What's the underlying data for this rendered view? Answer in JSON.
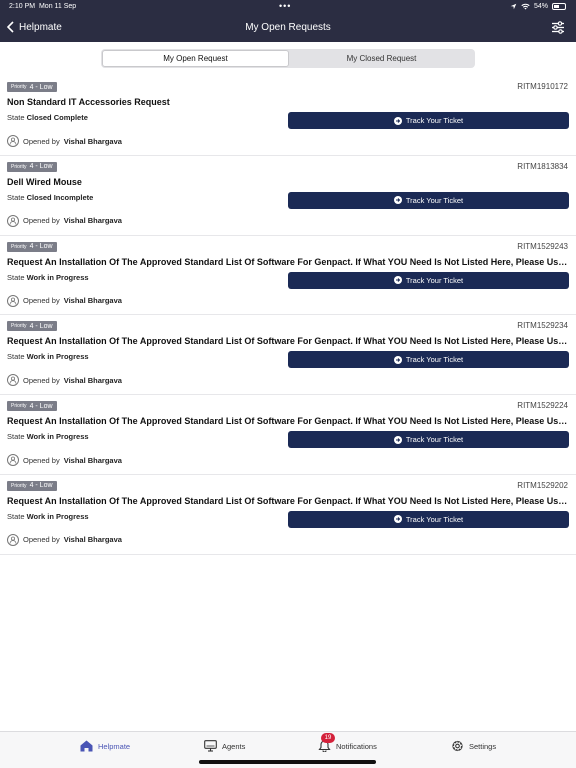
{
  "status_bar": {
    "time": "2:10 PM",
    "date": "Mon 11 Sep",
    "dots": "•••",
    "battery": "54%",
    "battery_level": 0.54
  },
  "nav": {
    "back_label": "Helpmate",
    "title": "My Open Requests"
  },
  "segment": {
    "open_label": "My Open Request",
    "closed_label": "My Closed Request"
  },
  "labels": {
    "priority": "Priority",
    "state": "State",
    "opened_by": "Opened by",
    "track": "Track Your Ticket"
  },
  "requests": [
    {
      "priority": "4 - Low",
      "id": "RITM1910172",
      "title": "Non Standard IT Accessories Request",
      "state": "Closed Complete",
      "opened_by": "Vishal Bhargava"
    },
    {
      "priority": "4 - Low",
      "id": "RITM1813834",
      "title": "Dell Wired Mouse",
      "state": "Closed Incomplete",
      "opened_by": "Vishal Bhargava"
    },
    {
      "priority": "4 - Low",
      "id": "RITM1529243",
      "title": "Request An Installation Of The Approved Standard List Of Software For Genpact. If What YOU Need Is Not Listed Here, Please Use...",
      "state": "Work in Progress",
      "opened_by": "Vishal Bhargava"
    },
    {
      "priority": "4 - Low",
      "id": "RITM1529234",
      "title": "Request An Installation Of The Approved Standard List Of Software For Genpact. If What YOU Need Is Not Listed Here, Please Use...",
      "state": "Work in Progress",
      "opened_by": "Vishal Bhargava"
    },
    {
      "priority": "4 - Low",
      "id": "RITM1529224",
      "title": "Request An Installation Of The Approved Standard List Of Software For Genpact. If What YOU Need Is Not Listed Here, Please Use...",
      "state": "Work in Progress",
      "opened_by": "Vishal Bhargava"
    },
    {
      "priority": "4 - Low",
      "id": "RITM1529202",
      "title": "Request An Installation Of The Approved Standard List Of Software For Genpact. If What YOU Need Is Not Listed Here, Please Use...",
      "state": "Work in Progress",
      "opened_by": "Vishal Bhargava"
    }
  ],
  "tabbar": {
    "home": "Helpmate",
    "agents": "Agents",
    "notifications": "Notifications",
    "notifications_count": "19",
    "settings": "Settings"
  },
  "colors": {
    "header": "#2b2d42",
    "button": "#1b2a55",
    "active_tab": "#4a55b5",
    "badge": "#d4213a"
  }
}
